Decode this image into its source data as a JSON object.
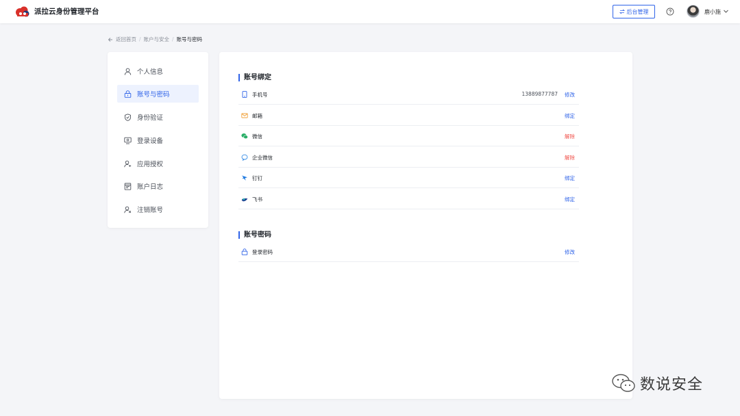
{
  "header": {
    "app_title": "派拉云身份管理平台",
    "admin_button_label": "后台管理",
    "username": "鹿小施"
  },
  "breadcrumb": {
    "back": "返回首页",
    "level1": "账户与安全",
    "current": "账号与密码",
    "separator": "/"
  },
  "sidebar": {
    "items": [
      {
        "label": "个人信息",
        "icon": "user-icon"
      },
      {
        "label": "账号与密码",
        "icon": "lock-icon",
        "active": true
      },
      {
        "label": "身份验证",
        "icon": "shield-check-icon"
      },
      {
        "label": "登录设备",
        "icon": "monitor-icon"
      },
      {
        "label": "应用授权",
        "icon": "user-key-icon"
      },
      {
        "label": "账户日志",
        "icon": "log-icon"
      },
      {
        "label": "注销账号",
        "icon": "user-remove-icon"
      }
    ]
  },
  "binding": {
    "title": "账号绑定",
    "rows": [
      {
        "label": "手机号",
        "value": "13889877787",
        "action": "修改",
        "icon": "phone-icon"
      },
      {
        "label": "邮箱",
        "value": "",
        "action": "绑定",
        "icon": "mail-icon"
      },
      {
        "label": "微信",
        "value": "",
        "action": "解除",
        "icon": "wechat-icon"
      },
      {
        "label": "企业微信",
        "value": "",
        "action": "解除",
        "icon": "wecom-icon"
      },
      {
        "label": "钉钉",
        "value": "",
        "action": "绑定",
        "icon": "dingtalk-icon"
      },
      {
        "label": "飞书",
        "value": "",
        "action": "绑定",
        "icon": "feishu-icon"
      }
    ]
  },
  "password": {
    "title": "账号密码",
    "rows": [
      {
        "label": "登录密码",
        "action": "修改",
        "icon": "lock-icon"
      }
    ]
  },
  "watermark": {
    "text": "数说安全"
  },
  "colors": {
    "accent": "#2f63e8",
    "danger": "#f0524b",
    "background": "#f4f5f8"
  }
}
